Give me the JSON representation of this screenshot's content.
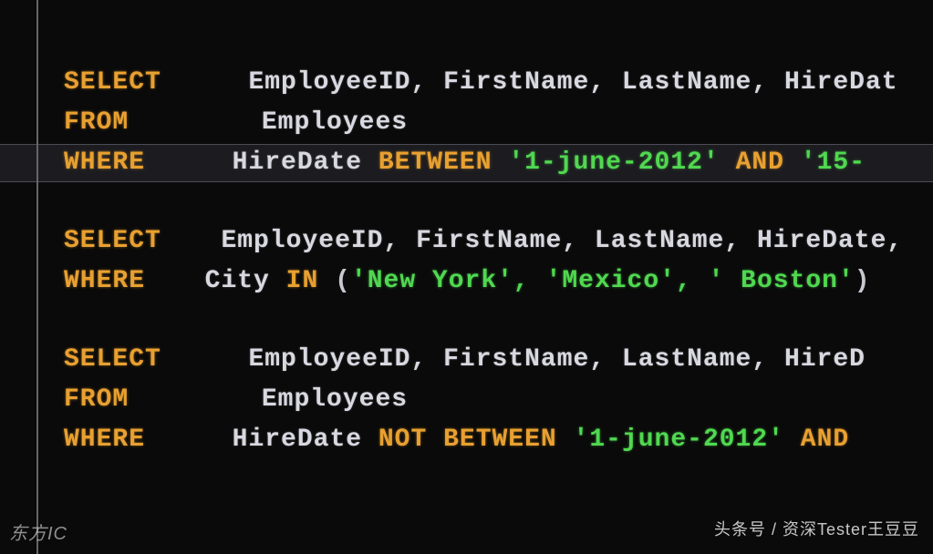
{
  "query1": {
    "select": "SELECT",
    "from": "FROM",
    "where": "WHERE",
    "columns": "EmployeeID, FirstName, LastName, HireDat",
    "table": "Employees",
    "whereCol": "HireDate",
    "between": "BETWEEN",
    "date1": "'1-june-2012'",
    "and": "AND",
    "date2": "'15-"
  },
  "query2": {
    "select": "SELECT",
    "where": "WHERE",
    "columns": "EmployeeID, FirstName, LastName, HireDate,",
    "city": "City",
    "in": "IN",
    "parenOpen": "(",
    "cities": "'New York', 'Mexico', ' Boston'",
    "parenClose": ")"
  },
  "query3": {
    "select": "SELECT",
    "from": "FROM",
    "where": "WHERE",
    "columns": "EmployeeID, FirstName, LastName, HireD",
    "table": "Employees",
    "whereCol": "HireDate",
    "notBetween": "NOT BETWEEN",
    "date1": "'1-june-2012'",
    "and": "AND"
  },
  "watermarkLeft": "东方IC",
  "watermarkRight": "头条号 / 资深Tester王豆豆"
}
